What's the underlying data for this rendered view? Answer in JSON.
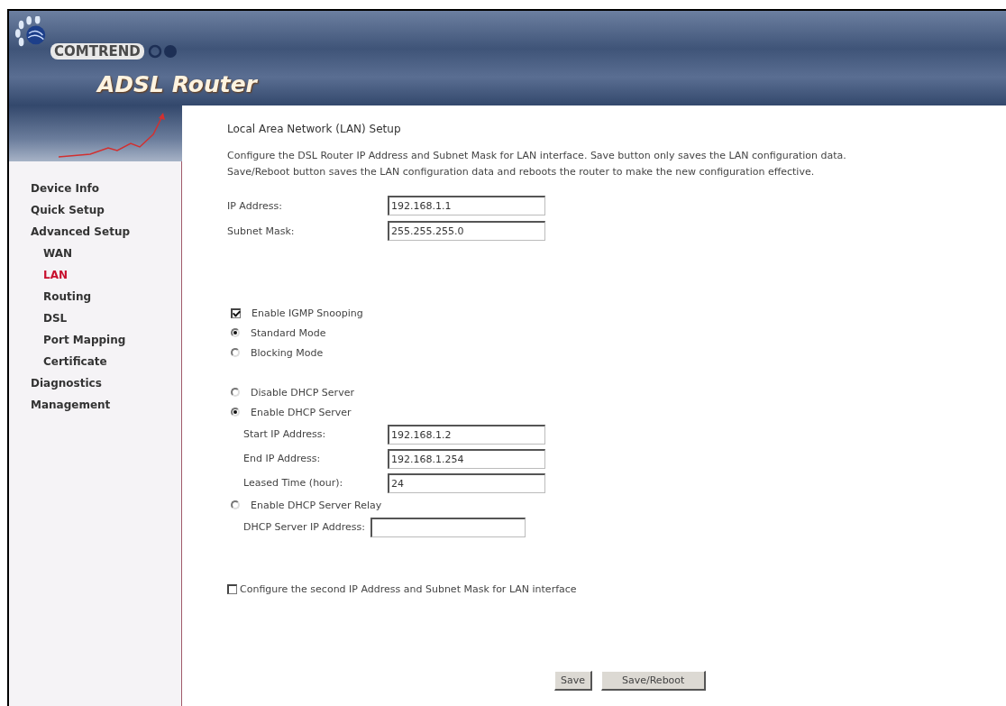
{
  "brand": {
    "company": "COMTREND",
    "product": "ADSL Router"
  },
  "sidebar": {
    "items": [
      {
        "label": "Device Info",
        "selected": false
      },
      {
        "label": "Quick Setup",
        "selected": false
      },
      {
        "label": "Advanced Setup",
        "selected": false,
        "children": [
          {
            "label": "WAN",
            "selected": false
          },
          {
            "label": "LAN",
            "selected": true
          },
          {
            "label": "Routing",
            "selected": false
          },
          {
            "label": "DSL",
            "selected": false
          },
          {
            "label": "Port Mapping",
            "selected": false
          },
          {
            "label": "Certificate",
            "selected": false
          }
        ]
      },
      {
        "label": "Diagnostics",
        "selected": false
      },
      {
        "label": "Management",
        "selected": false
      }
    ]
  },
  "page": {
    "title": "Local Area Network (LAN) Setup",
    "description": [
      "Configure the DSL Router IP Address and Subnet Mask for LAN interface.  Save button only saves the LAN configuration data.",
      "Save/Reboot button saves the LAN configuration data and reboots the router to make the new configuration effective."
    ],
    "address_fields": [
      {
        "label": "IP Address:",
        "value": "192.168.1.1"
      },
      {
        "label": "Subnet Mask:",
        "value": "255.255.255.0"
      }
    ],
    "igmp": [
      {
        "kind": "checkbox",
        "label": "Enable IGMP Snooping",
        "checked": true
      },
      {
        "kind": "radio",
        "label": "Standard Mode",
        "selected": true
      },
      {
        "kind": "radio",
        "label": "Blocking Mode",
        "selected": false
      }
    ],
    "dhcp": [
      {
        "kind": "radio",
        "label": "Disable DHCP Server",
        "selected": false
      },
      {
        "kind": "radio",
        "label": "Enable DHCP Server",
        "selected": true,
        "fields": [
          {
            "label": "Start IP Address:",
            "value": "192.168.1.2"
          },
          {
            "label": "End IP Address:",
            "value": "192.168.1.254"
          },
          {
            "label": "Leased Time (hour):",
            "value": "24"
          }
        ]
      },
      {
        "kind": "radio",
        "label": "Enable DHCP Server Relay",
        "selected": false,
        "fields": [
          {
            "label": "DHCP Server IP Address:"
          }
        ]
      }
    ],
    "second_address": {
      "label": "Configure the second IP Address and Subnet Mask for LAN interface",
      "checked": false
    },
    "buttons": [
      "Save",
      "Save/Reboot"
    ]
  }
}
